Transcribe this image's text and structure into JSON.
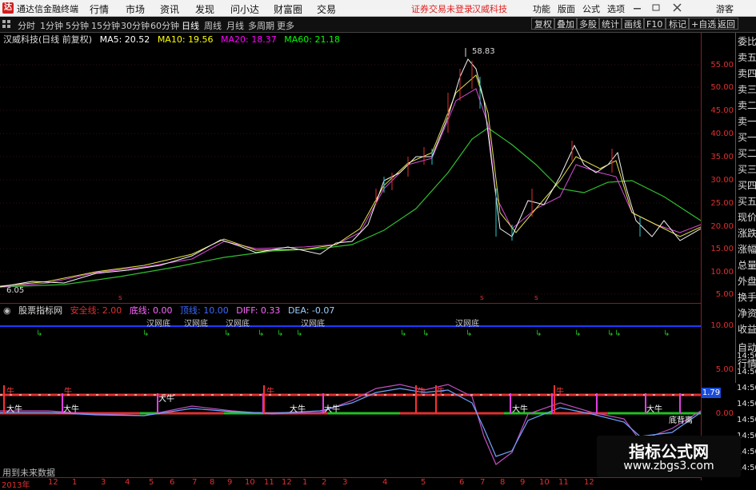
{
  "app": {
    "title": "通达信金融终端",
    "logo": "达"
  },
  "menu": [
    "行情",
    "市场",
    "资讯",
    "发现",
    "问小达",
    "财富圈",
    "交易"
  ],
  "warning": "证券交易未登录",
  "stock_name_top": "汉威科技",
  "right_menu": [
    "功能",
    "版面",
    "公式",
    "选项",
    "游客"
  ],
  "periods": [
    "分时",
    "1分钟",
    "5分钟",
    "15分钟",
    "30分钟",
    "60分钟",
    "日线",
    "周线",
    "月线",
    "多周期",
    "更多"
  ],
  "active_period": "日线",
  "toolbar_right": [
    "复权",
    "叠加",
    "多股",
    "统计",
    "画线",
    "F10",
    "标记",
    "+自选",
    "返回"
  ],
  "info": {
    "title": "汉威科技(日线 前复权)",
    "ma5": "MA5: 20.52",
    "ma10": "MA10: 19.56",
    "ma20": "MA20: 18.37",
    "ma60": "MA60: 21.18",
    "colors": {
      "ma5": "#ffffff",
      "ma10": "#ffff00",
      "ma20": "#ff00ff",
      "ma60": "#00ff00"
    }
  },
  "price_max": "58.83",
  "price_min": "6.05",
  "y_axis": [
    "55.00",
    "50.00",
    "45.00",
    "40.00",
    "35.00",
    "30.00",
    "25.00",
    "20.00",
    "15.00",
    "10.00",
    "5.00"
  ],
  "side_panel": [
    "委比",
    "卖五",
    "卖四",
    "卖三",
    "卖二",
    "卖一",
    "买一",
    "买二",
    "买三",
    "买四",
    "买五",
    "现价",
    "涨跌",
    "涨幅",
    "总量",
    "外盘",
    "换手",
    "净资",
    "收益",
    "自动",
    "行情"
  ],
  "side_panel_times": [
    "14:50",
    "14:50",
    "14:50",
    "14:50",
    "14:50",
    "14:50",
    "14:50",
    "14:50"
  ],
  "indicator": {
    "name": "股票指标网",
    "safe": "安全线: 2.00",
    "bottom": "底线: 0.00",
    "top": "顶线: 10.00",
    "diff": "DIFF: 0.33",
    "dea": "DEA: -0.07"
  },
  "ind_axis": [
    "10.00",
    "5.00",
    "0.00"
  ],
  "ind_value": "1.79",
  "signals_top": [
    "汉网底",
    "汉网底",
    "汉网底",
    "汉网底",
    "汉网底"
  ],
  "signals_bull_red": [
    "牛",
    "牛",
    "牛",
    "牛",
    "牛",
    "牛"
  ],
  "signals_bull_white": [
    "大牛",
    "大牛",
    "大牛",
    "大牛",
    "大牛",
    "大牛",
    "大牛"
  ],
  "bottom_label": "底背离",
  "future_label": "用到未来数据",
  "x_axis": [
    "2013年",
    "12",
    "1",
    "3",
    "4",
    "5",
    "6",
    "7",
    "8",
    "9",
    "10",
    "11",
    "12",
    "1",
    "2",
    "3",
    "4",
    "5",
    "6",
    "7",
    "8",
    "9",
    "10",
    "11",
    "12"
  ],
  "watermark": {
    "line1": "指标公式网",
    "line2": "www.zbgs3.com"
  }
}
